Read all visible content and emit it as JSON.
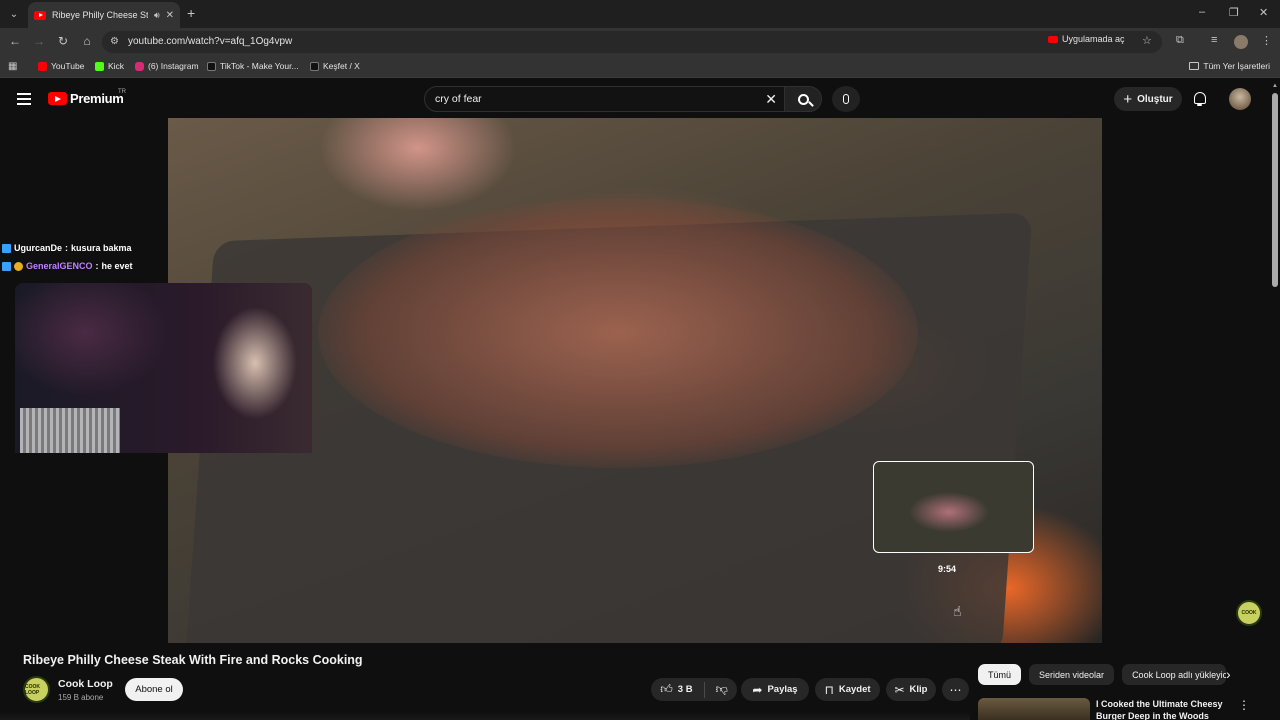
{
  "browser": {
    "tab": {
      "title": "Ribeye Philly Cheese Steak With Fire and Rocks Cooking - YouTube"
    },
    "window_controls": {
      "minimize": "–",
      "restore": "❐",
      "close": "✕"
    },
    "address_bar": {
      "url": "youtube.com/watch?v=afq_1Og4vpw",
      "open_in_app_label": "Uygulamada aç"
    },
    "bookmarks": [
      {
        "label": "YouTube",
        "color": "#ff0000"
      },
      {
        "label": "Kick",
        "color": "#53fc18"
      },
      {
        "label": "(6) Instagram",
        "color": "#d62976"
      },
      {
        "label": "TikTok - Make Your...",
        "color": "#111111"
      },
      {
        "label": "Keşfet / X",
        "color": "#111111"
      }
    ],
    "all_bookmarks_label": "Tüm Yer İşaretleri"
  },
  "youtube": {
    "logo_text": "Premium",
    "country_code": "TR",
    "search": {
      "query": "cry of fear"
    },
    "create_label": "Oluştur"
  },
  "player": {
    "preview_time": "9:54",
    "chat": [
      {
        "user": "UgurcanDe",
        "message": "kusura bakma",
        "user_color": "#ffffff"
      },
      {
        "user": "GeneralGENCO",
        "message": "he evet",
        "user_color": "#c080ff"
      }
    ]
  },
  "video": {
    "title": "Ribeye Philly Cheese Steak With Fire and Rocks Cooking",
    "channel": {
      "name": "Cook Loop",
      "subscribers": "159 B abone",
      "avatar_text": "COOK LOOP"
    },
    "subscribe_label": "Abone ol",
    "actions": {
      "likes": "3 B",
      "share": "Paylaş",
      "save": "Kaydet",
      "clip": "Klip"
    }
  },
  "sidebar": {
    "chips": [
      "Tümü",
      "Seriden videolar",
      "Cook Loop adlı yükleyiciden"
    ],
    "recommendation": {
      "title": "I Cooked the Ultimate Cheesy Burger Deep in the Woods"
    }
  }
}
